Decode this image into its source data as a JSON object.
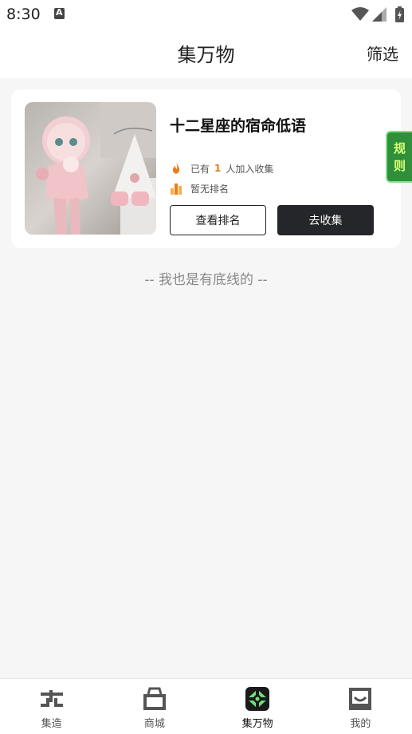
{
  "status_bar": {
    "time": "8:30",
    "notification_icon": "text-a-notification-icon",
    "wifi_icon": "wifi-icon",
    "signal_icon": "cell-signal-icon",
    "battery_icon": "battery-charging-icon"
  },
  "header": {
    "title": "集万物",
    "filter_label": "筛选"
  },
  "card": {
    "title": "十二星座的宿命低语",
    "image_description_icon": "figurine-image",
    "collect_prefix": "已有",
    "collect_count": "1",
    "collect_suffix": "人加入收集",
    "rank_text": "暂无排名",
    "rank_button": "查看排名",
    "collect_button": "去收集"
  },
  "rules_tab": {
    "line1": "规",
    "line2": "则"
  },
  "bottom_line_text": "-- 我也是有底线的 --",
  "nav": {
    "items": [
      {
        "label": "集造",
        "icon": "jizao-logo-icon"
      },
      {
        "label": "商城",
        "icon": "shopping-bag-icon"
      },
      {
        "label": "集万物",
        "icon": "jiwanwu-logo-icon"
      },
      {
        "label": "我的",
        "icon": "profile-box-icon"
      }
    ],
    "active_index": 2
  },
  "colors": {
    "accent_orange": "#e87c1e",
    "rules_tab_green": "#2f8f3a",
    "dark_button": "#25262a"
  }
}
